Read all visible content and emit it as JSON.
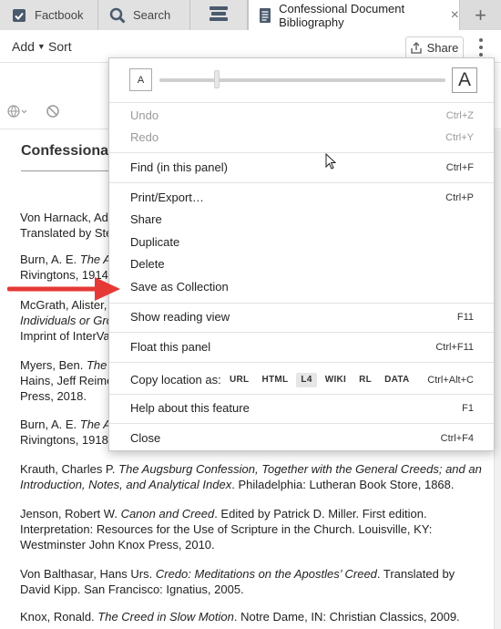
{
  "tabs": [
    {
      "label": "Factbook",
      "icon": "checkbox-icon"
    },
    {
      "label": "Search",
      "icon": "search-icon"
    },
    {
      "label": "",
      "icon": "layers-icon"
    },
    {
      "label": "Confessional Document Bibliography",
      "icon": "document-icon",
      "close": "×"
    }
  ],
  "tab_add": "+",
  "toolbar": {
    "add_label": "Add",
    "add_caret": "▼",
    "sort_label": "Sort",
    "share_label": "Share"
  },
  "doc": {
    "title": "Confessional",
    "entries": [
      {
        "lines": [
          [
            {
              "t": "Von Harnack, Ado"
            }
          ],
          [
            {
              "t": "Translated by Ste"
            }
          ]
        ]
      },
      {
        "lines": [
          [
            {
              "t": "Burn, A. E. "
            },
            {
              "t": "The Ap",
              "i": true
            }
          ],
          [
            {
              "t": "Rivingtons, 1914."
            }
          ]
        ]
      },
      {
        "lines": [
          [
            {
              "t": "McGrath, Alister,"
            }
          ],
          [
            {
              "t": "Individuals or Gro",
              "i": true
            }
          ],
          [
            {
              "t": "Imprint of InterVa"
            }
          ]
        ]
      },
      {
        "lines": [
          [
            {
              "t": "Myers, Ben. "
            },
            {
              "t": "The A",
              "i": true
            }
          ],
          [
            {
              "t": "Hains, Jeff Reime"
            }
          ],
          [
            {
              "t": "Press, 2018."
            }
          ]
        ]
      },
      {
        "lines": [
          [
            {
              "t": "Burn, A. E. "
            },
            {
              "t": "The At",
              "i": true
            }
          ],
          [
            {
              "t": "Rivingtons, 1918."
            }
          ]
        ]
      },
      {
        "lines": [
          [
            {
              "t": "Krauth, Charles P. "
            },
            {
              "t": "The Augsburg Confession, Together with the General Creeds; and an",
              "i": true
            }
          ],
          [
            {
              "t": "Introduction, Notes, and Analytical Index",
              "i": true
            },
            {
              "t": ". Philadelphia: Lutheran Book Store, 1868."
            }
          ]
        ]
      },
      {
        "lines": [
          [
            {
              "t": "Jenson, Robert W. "
            },
            {
              "t": "Canon and Creed",
              "i": true
            },
            {
              "t": ". Edited by Patrick D. Miller. First edition."
            }
          ],
          [
            {
              "t": "Interpretation: Resources for the Use of Scripture in the Church. Louisville, KY:"
            }
          ],
          [
            {
              "t": "Westminster John Knox Press, 2010."
            }
          ]
        ]
      },
      {
        "lines": [
          [
            {
              "t": "Von Balthasar, Hans Urs. "
            },
            {
              "t": "Credo: Meditations on the Apostles’ Creed",
              "i": true
            },
            {
              "t": ". Translated by"
            }
          ],
          [
            {
              "t": "David Kipp. San Francisco: Ignatius, 2005."
            }
          ]
        ]
      },
      {
        "lines": [
          [
            {
              "t": "Knox, Ronald. "
            },
            {
              "t": "The Creed in Slow Motion",
              "i": true
            },
            {
              "t": ". Notre Dame, IN: Christian Classics, 2009."
            }
          ]
        ]
      }
    ]
  },
  "menu": {
    "font_small": "A",
    "font_large": "A",
    "font_size_level": 0.2,
    "items": {
      "undo": {
        "label": "Undo",
        "shortcut": "Ctrl+Z"
      },
      "redo": {
        "label": "Redo",
        "shortcut": "Ctrl+Y"
      },
      "find": {
        "label": "Find (in this panel)",
        "shortcut": "Ctrl+F"
      },
      "print": {
        "label": "Print/Export…",
        "shortcut": "Ctrl+P"
      },
      "share": {
        "label": "Share"
      },
      "duplicate": {
        "label": "Duplicate"
      },
      "delete": {
        "label": "Delete"
      },
      "save_collection": {
        "label": "Save as Collection"
      },
      "reading_view": {
        "label": "Show reading view",
        "shortcut": "F11"
      },
      "float": {
        "label": "Float this panel",
        "shortcut": "Ctrl+F11"
      },
      "copy_location": {
        "label": "Copy location as:",
        "shortcut": "Ctrl+Alt+C",
        "formats": [
          "URL",
          "HTML",
          "L4",
          "WIKI",
          "RL",
          "DATA"
        ],
        "selected": "L4"
      },
      "help": {
        "label": "Help about this feature",
        "shortcut": "F1"
      },
      "close": {
        "label": "Close",
        "shortcut": "Ctrl+F4"
      }
    }
  },
  "colors": {
    "arrow": "#e53935",
    "tab_bar": "#dcdcdc",
    "text": "#222222"
  }
}
